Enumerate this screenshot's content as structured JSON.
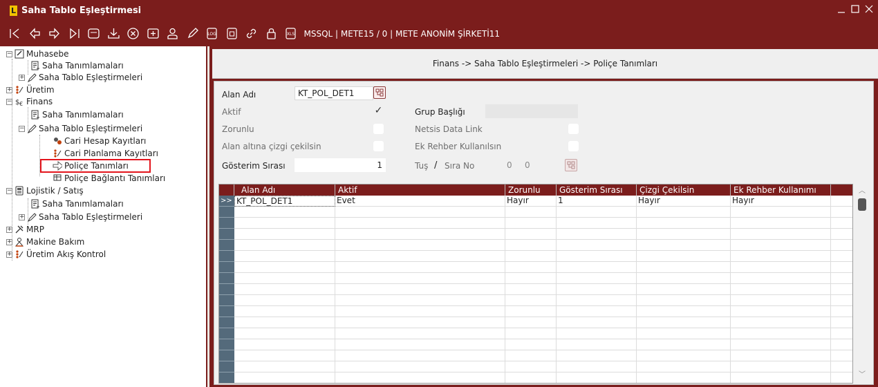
{
  "window": {
    "title": "Saha Tablo Eşleştirmesi",
    "app_icon_letter": "L",
    "controls": [
      "minimize",
      "maximize",
      "close"
    ]
  },
  "toolbar": {
    "buttons": [
      "first-record-icon",
      "previous-record-icon",
      "next-record-icon",
      "last-record-icon",
      "list-icon",
      "download-icon",
      "cancel-icon",
      "add-icon",
      "user-icon",
      "edit-icon",
      "log-icon",
      "lock-file-icon",
      "link-icon",
      "padlock-icon",
      "xls-icon"
    ],
    "status": "MSSQL | METE15 / 0 | METE ANONİM ŞİRKETİ11"
  },
  "tree": {
    "items": [
      {
        "label": "Muhasebe",
        "icon": "ledger-icon",
        "expander": "−"
      },
      {
        "label": "Saha Tanımlamaları",
        "icon": "field-def-icon"
      },
      {
        "label": "Saha Tablo Eşleştirmeleri",
        "icon": "mapping-icon",
        "expander": "+"
      },
      {
        "label": "Üretim",
        "icon": "production-icon",
        "expander": "+"
      },
      {
        "label": "Finans",
        "icon": "finance-icon",
        "expander": "−"
      },
      {
        "label": "Saha Tanımlamaları",
        "icon": "field-def-icon"
      },
      {
        "label": "Saha Tablo Eşleştirmeleri",
        "icon": "mapping-icon",
        "expander": "−"
      },
      {
        "label": "Cari Hesap Kayıtları",
        "icon": "account-icon"
      },
      {
        "label": "Cari Planlama Kayıtları",
        "icon": "planning-icon"
      },
      {
        "label": "Poliçe Tanımları",
        "icon": "arrow-right-icon"
      },
      {
        "label": "Poliçe Bağlantı Tanımları",
        "icon": "link-table-icon"
      },
      {
        "label": "Lojistik / Satış",
        "icon": "logistics-icon",
        "expander": "−"
      },
      {
        "label": "Saha Tanımlamaları",
        "icon": "field-def-icon"
      },
      {
        "label": "Saha Tablo Eşleştirmeleri",
        "icon": "mapping-icon",
        "expander": "+"
      },
      {
        "label": "MRP",
        "icon": "mrp-icon",
        "expander": "+"
      },
      {
        "label": "Makine Bakım",
        "icon": "maintenance-icon",
        "expander": "+"
      },
      {
        "label": "Üretim Akış Kontrol",
        "icon": "flow-icon",
        "expander": "+"
      }
    ]
  },
  "breadcrumb": "Finans -> Saha Tablo Eşleştirmeleri -> Poliçe Tanımları",
  "form": {
    "alan_adi_label": "Alan Adı",
    "alan_adi_value": "KT_POL_DET1",
    "aktif_label": "Aktif",
    "aktif_checked": true,
    "zorunlu_label": "Zorunlu",
    "alan_altina_label": "Alan altına çizgi çekilsin",
    "gosterim_label": "Gösterim Sırası",
    "gosterim_value": "1",
    "grup_basligi_label": "Grup Başlığı",
    "grup_basligi_value": "",
    "netsis_label": "Netsis Data Link",
    "ek_rehber_label": "Ek Rehber Kullanılsın",
    "tus_label": "Tuş",
    "slash": "/",
    "sira_no_label": "Sıra No",
    "tus_value": "0",
    "sira_value": "0"
  },
  "grid": {
    "columns": [
      "Alan Adı",
      "Aktif",
      "Zorunlu",
      "Gösterim Sırası",
      "Çizgi Çekilsin",
      "Ek Rehber Kullanımı"
    ],
    "row_indicator": ">>",
    "rows": [
      [
        "KT_POL_DET1",
        "Evet",
        "Hayır",
        "1",
        "Hayır",
        "Hayır"
      ]
    ]
  },
  "colors": {
    "brand": "#7b1d1c",
    "indicator": "#546a7b",
    "highlight": "#e3141c"
  }
}
